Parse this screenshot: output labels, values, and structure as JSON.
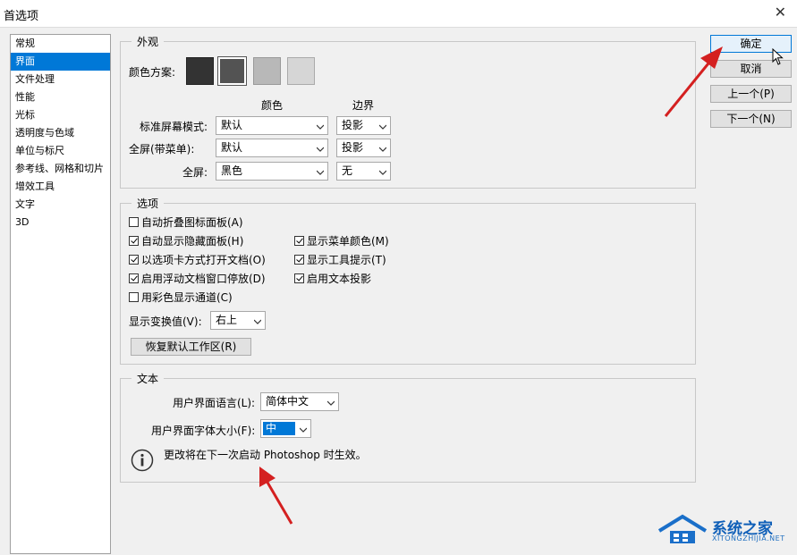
{
  "window": {
    "title": "首选项",
    "close_glyph": "✕"
  },
  "sidebar": {
    "items": [
      "常规",
      "界面",
      "文件处理",
      "性能",
      "光标",
      "透明度与色域",
      "单位与标尺",
      "参考线、网格和切片",
      "增效工具",
      "文字",
      "3D"
    ],
    "selected_index": 1
  },
  "appearance": {
    "legend": "外观",
    "color_scheme_label": "颜色方案:",
    "swatches": [
      "#333333",
      "#535353",
      "#b8b8b8",
      "#d6d6d6"
    ],
    "selected_swatch": 1,
    "col_color": "颜色",
    "col_border": "边界",
    "rows": [
      {
        "label": "标准屏幕模式:",
        "color": "默认",
        "border": "投影"
      },
      {
        "label": "全屏(带菜单):",
        "color": "默认",
        "border": "投影"
      },
      {
        "label": "全屏:",
        "color": "黑色",
        "border": "无"
      }
    ]
  },
  "options": {
    "legend": "选项",
    "checkboxes_left": [
      {
        "label": "自动折叠图标面板(A)",
        "checked": false
      },
      {
        "label": "自动显示隐藏面板(H)",
        "checked": true
      },
      {
        "label": "以选项卡方式打开文档(O)",
        "checked": true
      },
      {
        "label": "启用浮动文档窗口停放(D)",
        "checked": true
      },
      {
        "label": "用彩色显示通道(C)",
        "checked": false
      }
    ],
    "checkboxes_right": [
      {
        "label": "显示菜单颜色(M)",
        "checked": true
      },
      {
        "label": "显示工具提示(T)",
        "checked": true
      },
      {
        "label": "启用文本投影",
        "checked": true
      }
    ],
    "transform_label": "显示变换值(V):",
    "transform_value": "右上",
    "restore_button": "恢复默认工作区(R)"
  },
  "text_section": {
    "legend": "文本",
    "ui_language_label": "用户界面语言(L):",
    "ui_language_value": "简体中文",
    "ui_font_size_label": "用户界面字体大小(F):",
    "ui_font_size_value": "中",
    "notice": "更改将在下一次启动 Photoshop 时生效。"
  },
  "buttons": {
    "ok": "确定",
    "cancel": "取消",
    "prev": "上一个(P)",
    "next": "下一个(N)"
  },
  "watermark": {
    "name": "系统之家",
    "url": "XITONGZHIJIA.NET"
  },
  "colors": {
    "accent": "#0078d7",
    "arrow": "#d42020"
  }
}
